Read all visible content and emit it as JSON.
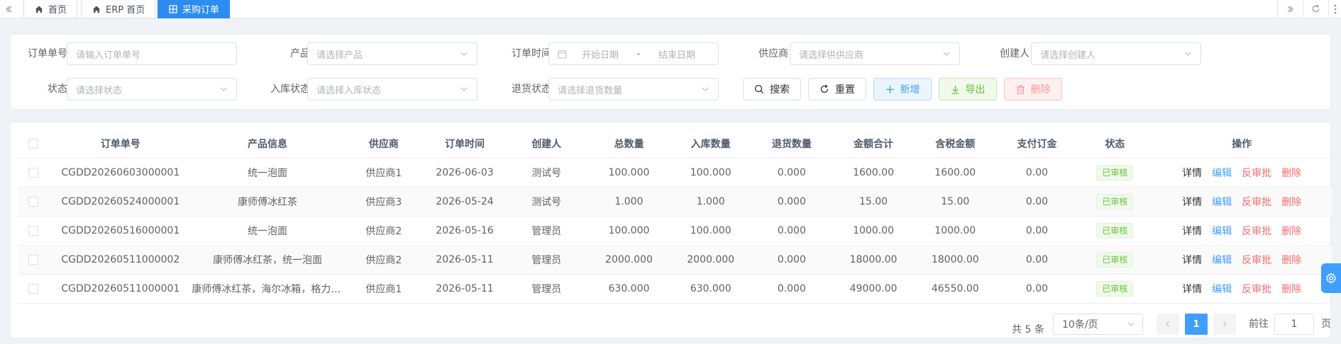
{
  "tabs": [
    {
      "label": "首页",
      "icon": "home-icon"
    },
    {
      "label": "ERP 首页",
      "icon": "home-icon"
    },
    {
      "label": "采购订单",
      "icon": "grid-icon",
      "active": true
    }
  ],
  "search": {
    "order_no": {
      "label": "订单单号",
      "placeholder": "请输入订单单号"
    },
    "product": {
      "label": "产品",
      "placeholder": "请选择产品"
    },
    "order_time": {
      "label": "订单时间",
      "start_placeholder": "开始日期",
      "separator": "-",
      "end_placeholder": "结束日期"
    },
    "supplier": {
      "label": "供应商",
      "placeholder": "请选择供供应商"
    },
    "creator": {
      "label": "创建人",
      "placeholder": "请选择创建人"
    },
    "status": {
      "label": "状态",
      "placeholder": "请选择状态"
    },
    "in_status": {
      "label": "入库状态",
      "placeholder": "请选择入库状态"
    },
    "return_status": {
      "label": "退货状态",
      "placeholder": "请选择退货数量"
    },
    "buttons": {
      "search": "搜索",
      "reset": "重置",
      "add": "新增",
      "export": "导出",
      "delete": "删除"
    }
  },
  "table": {
    "headers": [
      "订单单号",
      "产品信息",
      "供应商",
      "订单时间",
      "创建人",
      "总数量",
      "入库数量",
      "退货数量",
      "金额合计",
      "含税金额",
      "支付订金",
      "状态",
      "操作"
    ],
    "rows": [
      {
        "order_no": "CGDD20260603000001",
        "product": "统一泡面",
        "supplier": "供应商1",
        "date": "2026-06-03",
        "creator": "测试号",
        "total_qty": "100.000",
        "in_qty": "100.000",
        "return_qty": "0.000",
        "amount": "1600.00",
        "tax_amount": "1600.00",
        "deposit": "0.00",
        "status": "已审核"
      },
      {
        "order_no": "CGDD20260524000001",
        "product": "康师傅冰红茶",
        "supplier": "供应商3",
        "date": "2026-05-24",
        "creator": "测试号",
        "total_qty": "1.000",
        "in_qty": "1.000",
        "return_qty": "0.000",
        "amount": "15.00",
        "tax_amount": "15.00",
        "deposit": "0.00",
        "status": "已审核"
      },
      {
        "order_no": "CGDD20260516000001",
        "product": "统一泡面",
        "supplier": "供应商2",
        "date": "2026-05-16",
        "creator": "管理员",
        "total_qty": "100.000",
        "in_qty": "100.000",
        "return_qty": "0.000",
        "amount": "1000.00",
        "tax_amount": "1000.00",
        "deposit": "0.00",
        "status": "已审核"
      },
      {
        "order_no": "CGDD20260511000002",
        "product": "康师傅冰红茶，统一泡面",
        "supplier": "供应商2",
        "date": "2026-05-11",
        "creator": "管理员",
        "total_qty": "2000.000",
        "in_qty": "2000.000",
        "return_qty": "0.000",
        "amount": "18000.00",
        "tax_amount": "18000.00",
        "deposit": "0.00",
        "status": "已审核"
      },
      {
        "order_no": "CGDD20260511000001",
        "product": "康师傅冰红茶，海尔冰箱，格力空调…",
        "supplier": "供应商1",
        "date": "2026-05-11",
        "creator": "管理员",
        "total_qty": "630.000",
        "in_qty": "630.000",
        "return_qty": "0.000",
        "amount": "49000.00",
        "tax_amount": "46550.00",
        "deposit": "0.00",
        "status": "已审核"
      }
    ],
    "ops": {
      "detail": "详情",
      "edit": "编辑",
      "unaudit": "反审批",
      "delete": "删除"
    }
  },
  "pagination": {
    "total": "共 5 条",
    "page_size": "10条/页",
    "current_page": "1",
    "goto_label": "前往",
    "goto_value": "1",
    "page_suffix": "页"
  },
  "colors": {
    "primary": "#409eff",
    "tab_active": "#2d8cf0",
    "success": "#67c23a",
    "danger": "#f56c6c"
  }
}
